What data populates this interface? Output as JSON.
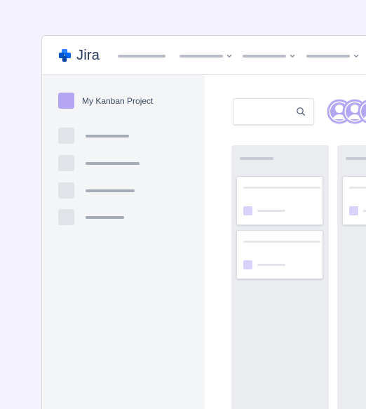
{
  "app": {
    "name": "Jira"
  },
  "header": {
    "nav": [
      {
        "name": "nav-item-1",
        "has_dropdown": false
      },
      {
        "name": "nav-item-2",
        "has_dropdown": true
      },
      {
        "name": "nav-item-3",
        "has_dropdown": true
      },
      {
        "name": "nav-item-4",
        "has_dropdown": true
      }
    ]
  },
  "sidebar": {
    "project_name": "My Kanban Project",
    "items": [
      {
        "icon": "sidebar-placeholder-icon"
      },
      {
        "icon": "sidebar-placeholder-icon"
      },
      {
        "icon": "sidebar-placeholder-icon"
      },
      {
        "icon": "sidebar-placeholder-icon"
      }
    ]
  },
  "board": {
    "search": {
      "value": "",
      "placeholder": "",
      "icon": "search-icon"
    },
    "avatars": [
      {
        "icon": "user-avatar-icon"
      },
      {
        "icon": "user-avatar-icon"
      },
      {
        "icon": "user-avatar-icon"
      }
    ],
    "columns": [
      {
        "name": "column-1",
        "card_count": 2
      },
      {
        "name": "column-2",
        "card_count": 1
      }
    ]
  },
  "colors": {
    "background": "#f4f3fd",
    "accent": "#b5a6f4",
    "jira_blue": "#2684ff",
    "text_primary": "#253858"
  }
}
